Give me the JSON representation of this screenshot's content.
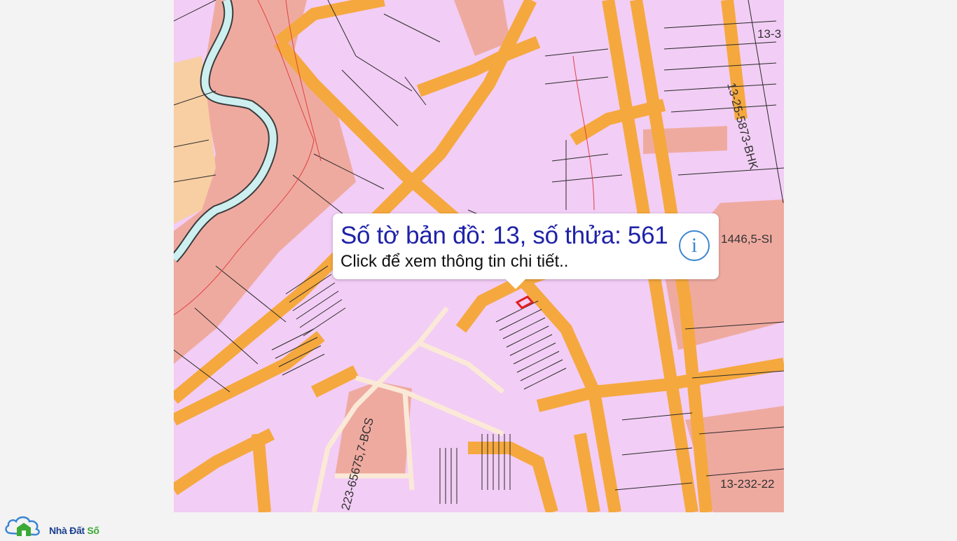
{
  "map": {
    "parcel_labels": [
      "13-3",
      "13-25-5873-BHK",
      "1446,5-SI",
      "223-65675,7-BCS",
      "13-232-22"
    ]
  },
  "popup": {
    "title": "Số tờ bản đồ: 13, số thửa: 561",
    "subtitle": "Click để xem thông tin chi tiết..",
    "info_icon": "info-icon"
  },
  "brand": {
    "name_part1": "Nhà Đất",
    "name_part2": " Số",
    "icon": "house-cloud-icon"
  },
  "colors": {
    "parcel": "#f2cdf5",
    "road": "#f5a83e",
    "residential": "#efaaa0",
    "river": "#cdeff0",
    "popup_title": "#1f22a8",
    "info_icon": "#3b86d1"
  }
}
